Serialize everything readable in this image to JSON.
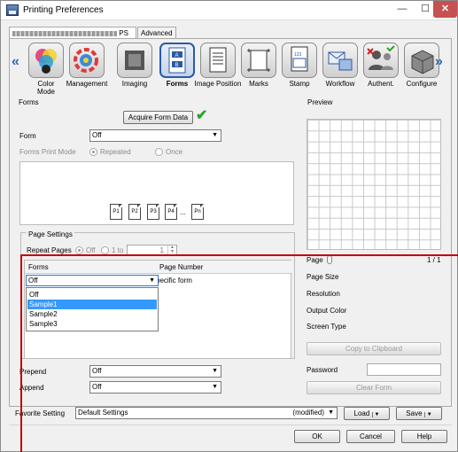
{
  "window": {
    "title": "Printing Preferences",
    "min_glyph": "—",
    "max_glyph": "☐",
    "close_glyph": "✕"
  },
  "tabs": {
    "main_suffix": "PS",
    "advanced": "Advanced"
  },
  "ribbon": {
    "items": [
      {
        "label": "Color\nMode",
        "icon": "color-mode-icon"
      },
      {
        "label": "Management",
        "icon": "management-icon"
      },
      {
        "label": "Imaging",
        "icon": "imaging-icon"
      },
      {
        "label": "Forms",
        "icon": "forms-icon"
      },
      {
        "label": "Image Position",
        "icon": "image-position-icon"
      },
      {
        "label": "Marks",
        "icon": "marks-icon"
      },
      {
        "label": "Stamp",
        "icon": "stamp-icon"
      },
      {
        "label": "Workflow",
        "icon": "workflow-icon"
      },
      {
        "label": "Authent.",
        "icon": "authentication-icon"
      },
      {
        "label": "Configure",
        "icon": "configure-icon"
      }
    ],
    "active": "Forms",
    "left_arrow": "«",
    "right_arrow": "»"
  },
  "forms": {
    "group_label": "Forms",
    "acquire_button": "Acquire Form Data",
    "form_label": "Form",
    "form_value": "Off",
    "print_mode_label": "Forms Print Mode",
    "repeated_label": "Repeated",
    "once_label": "Once",
    "pages": [
      "P1",
      "P2",
      "P3",
      "P4",
      "...",
      "Pn"
    ]
  },
  "page_settings": {
    "group_label": "Page Settings",
    "repeat_pages_label": "Repeat Pages",
    "off_label": "Off",
    "one_to_label": "1 to",
    "spin_value": "1",
    "col_forms": "Forms",
    "col_page_number": "Page Number",
    "page_number_text": "pecific form",
    "dropdown_value": "Off",
    "options": [
      "Off",
      "Sample1",
      "Sample2",
      "Sample3"
    ],
    "highlighted": "Sample1"
  },
  "prepend": {
    "label": "Prepend",
    "value": "Off"
  },
  "append": {
    "label": "Append",
    "value": "Off"
  },
  "preview": {
    "label": "Preview",
    "page_label": "Page",
    "page_count": "1 / 1",
    "page_size_label": "Page Size",
    "resolution_label": "Resolution",
    "output_color_label": "Output Color",
    "screen_type_label": "Screen Type",
    "copy_button": "Copy to Clipboard",
    "password_label": "Password",
    "clear_button": "Clear Form"
  },
  "favorite": {
    "label": "Favorite Setting",
    "value": "Default Settings",
    "modified": "(modified)",
    "load_button": "Load",
    "save_button": "Save"
  },
  "footer": {
    "ok": "OK",
    "cancel": "Cancel",
    "help": "Help"
  },
  "colors": {
    "highlight": "#3399ff",
    "accent": "#2b5aa3",
    "annotation": "#c00000",
    "check": "#2ea12e"
  }
}
